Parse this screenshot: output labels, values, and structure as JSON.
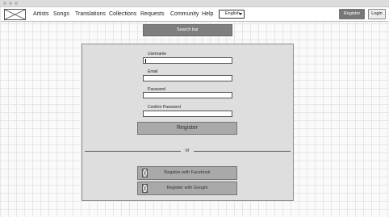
{
  "nav": {
    "items": [
      "Artists",
      "Songs",
      "Translations",
      "Collections",
      "Requests",
      "Community",
      "Help"
    ],
    "language": "English",
    "register_label": "Register",
    "login_label": "Login"
  },
  "search": {
    "label": "Search bar"
  },
  "form": {
    "fields": [
      {
        "label": "Username",
        "value": ""
      },
      {
        "label": "Email",
        "value": ""
      },
      {
        "label": "Password",
        "value": ""
      },
      {
        "label": "Confirm Password",
        "value": ""
      }
    ],
    "register_label": "Register",
    "separator": "or",
    "facebook_label": "Register with Facebook",
    "google_label": "Register with Google"
  },
  "icons": {
    "logo": "image-placeholder-icon",
    "language_caret": "caret-down-icon",
    "social": "image-placeholder-icon"
  },
  "colors": {
    "primary_button": "#777777",
    "search_bar": "#7f7f7f",
    "panel": "#dedede",
    "secondary_button": "#a9a9a9"
  }
}
